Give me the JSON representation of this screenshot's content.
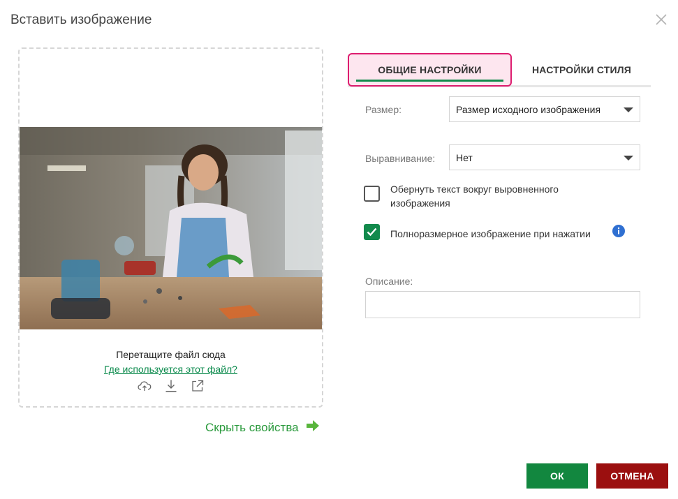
{
  "dialog": {
    "title": "Вставить изображение"
  },
  "dropzone": {
    "drop_text": "Перетащите файл сюда",
    "usage_link": "Где используется этот файл?",
    "icons": [
      "cloud-upload-icon",
      "download-icon",
      "external-link-icon"
    ]
  },
  "hide_properties": {
    "label": "Скрыть свойства",
    "icon": "arrow-right-icon"
  },
  "tabs": [
    {
      "label": "ОБЩИЕ НАСТРОЙКИ",
      "active": true
    },
    {
      "label": "НАСТРОЙКИ СТИЛЯ",
      "active": false
    }
  ],
  "form": {
    "size": {
      "label": "Размер:",
      "value": "Размер исходного изображения"
    },
    "alignment": {
      "label": "Выравнивание:",
      "value": "Нет"
    },
    "wrap_text": {
      "label": "Обернуть текст вокруг выровненного изображения",
      "checked": false
    },
    "fullsize_on_click": {
      "label": "Полноразмерное изображение при нажатии",
      "checked": true,
      "info_icon": "info-icon"
    },
    "description": {
      "label": "Описание:",
      "value": ""
    }
  },
  "buttons": {
    "ok": "ОК",
    "cancel": "ОТМЕНА"
  },
  "colors": {
    "accent_green": "#128a4c",
    "cancel_red": "#9b0f0f",
    "tab_highlight": "#dd1d6f",
    "link_green": "#2b9a3d"
  }
}
